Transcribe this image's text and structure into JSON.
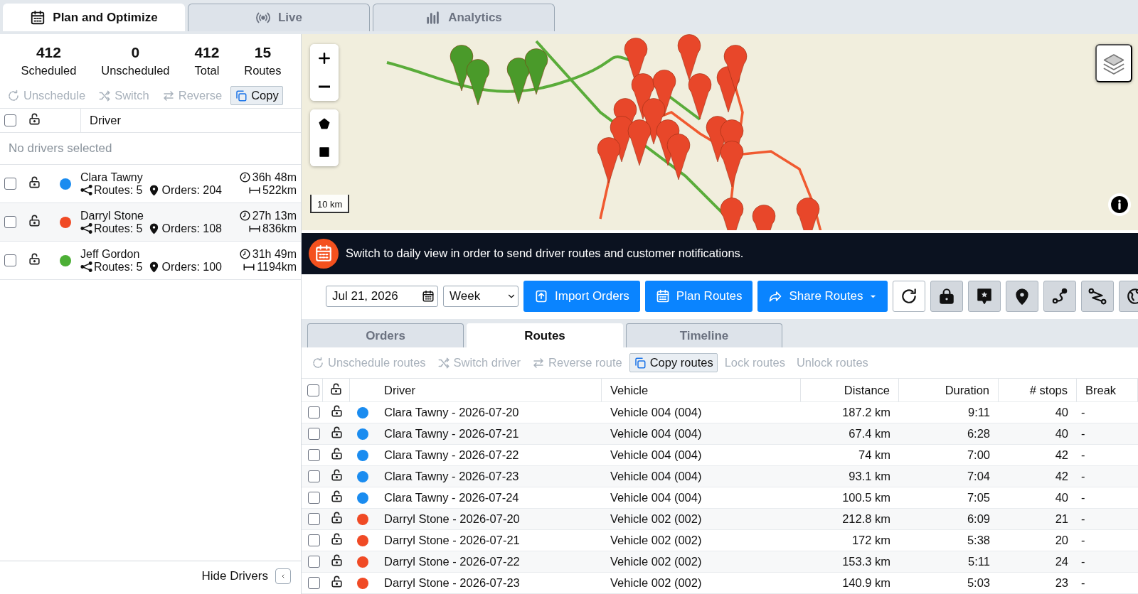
{
  "top_tabs": [
    {
      "label": "Plan and Optimize",
      "selected": true
    },
    {
      "label": "Live",
      "selected": false
    },
    {
      "label": "Analytics",
      "selected": false
    }
  ],
  "summary": [
    {
      "value": "412",
      "label": "Scheduled"
    },
    {
      "value": "0",
      "label": "Unscheduled"
    },
    {
      "value": "412",
      "label": "Total"
    },
    {
      "value": "15",
      "label": "Routes"
    }
  ],
  "driver_actions": [
    {
      "label": "Unschedule",
      "disabled": true
    },
    {
      "label": "Switch",
      "disabled": true
    },
    {
      "label": "Reverse",
      "disabled": true
    },
    {
      "label": "Copy",
      "disabled": false
    }
  ],
  "driver_table": {
    "header": "Driver",
    "all_checked": false,
    "empty_message": "No drivers selected",
    "drivers": [
      {
        "name": "Clara Tawny",
        "color": "#1a8cf0",
        "checked": false,
        "routes": "Routes: 5",
        "orders": "Orders: 204",
        "duration": "36h 48m",
        "distance": "522km"
      },
      {
        "name": "Darryl Stone",
        "color": "#f04a25",
        "checked": false,
        "routes": "Routes: 5",
        "orders": "Orders: 108",
        "duration": "27h 13m",
        "distance": "836km"
      },
      {
        "name": "Jeff Gordon",
        "color": "#4caf35",
        "checked": false,
        "routes": "Routes: 5",
        "orders": "Orders: 100",
        "duration": "31h 49m",
        "distance": "1194km"
      }
    ]
  },
  "hide_drivers": "Hide Drivers",
  "map": {
    "scale": "10 km"
  },
  "banner": "Switch to daily view in order to send driver routes and customer notifications.",
  "toolbar": {
    "date": "Jul 21, 2026",
    "period": "Week",
    "buttons": [
      {
        "label": "Import Orders"
      },
      {
        "label": "Plan Routes"
      },
      {
        "label": "Share Routes"
      }
    ]
  },
  "sub_tabs": [
    {
      "label": "Orders",
      "selected": false
    },
    {
      "label": "Routes",
      "selected": true
    },
    {
      "label": "Timeline",
      "selected": false
    }
  ],
  "route_actions": [
    {
      "label": "Unschedule routes",
      "disabled": true
    },
    {
      "label": "Switch driver",
      "disabled": true
    },
    {
      "label": "Reverse route",
      "disabled": true
    },
    {
      "label": "Copy routes",
      "disabled": false
    },
    {
      "label": "Lock routes",
      "disabled": true
    },
    {
      "label": "Unlock routes",
      "disabled": true
    }
  ],
  "routes_table": {
    "columns": [
      "Driver",
      "Vehicle",
      "Distance",
      "Duration",
      "# stops",
      "Break"
    ],
    "all_checked": false,
    "rows": [
      {
        "checked": false,
        "color": "#1a8cf0",
        "driver": "Clara Tawny - 2026-07-20",
        "vehicle": "Vehicle 004 (004)",
        "distance": "187.2 km",
        "duration": "9:11",
        "stops": "40",
        "break": "-"
      },
      {
        "checked": false,
        "color": "#1a8cf0",
        "driver": "Clara Tawny - 2026-07-21",
        "vehicle": "Vehicle 004 (004)",
        "distance": "67.4 km",
        "duration": "6:28",
        "stops": "40",
        "break": "-"
      },
      {
        "checked": false,
        "color": "#1a8cf0",
        "driver": "Clara Tawny - 2026-07-22",
        "vehicle": "Vehicle 004 (004)",
        "distance": "74 km",
        "duration": "7:00",
        "stops": "42",
        "break": "-"
      },
      {
        "checked": false,
        "color": "#1a8cf0",
        "driver": "Clara Tawny - 2026-07-23",
        "vehicle": "Vehicle 004 (004)",
        "distance": "93.1 km",
        "duration": "7:04",
        "stops": "42",
        "break": "-"
      },
      {
        "checked": false,
        "color": "#1a8cf0",
        "driver": "Clara Tawny - 2026-07-24",
        "vehicle": "Vehicle 004 (004)",
        "distance": "100.5 km",
        "duration": "7:05",
        "stops": "40",
        "break": "-"
      },
      {
        "checked": false,
        "color": "#f04a25",
        "driver": "Darryl Stone - 2026-07-20",
        "vehicle": "Vehicle 002 (002)",
        "distance": "212.8 km",
        "duration": "6:09",
        "stops": "21",
        "break": "-"
      },
      {
        "checked": false,
        "color": "#f04a25",
        "driver": "Darryl Stone - 2026-07-21",
        "vehicle": "Vehicle 002 (002)",
        "distance": "172 km",
        "duration": "5:38",
        "stops": "20",
        "break": "-"
      },
      {
        "checked": false,
        "color": "#f04a25",
        "driver": "Darryl Stone - 2026-07-22",
        "vehicle": "Vehicle 002 (002)",
        "distance": "153.3 km",
        "duration": "5:11",
        "stops": "24",
        "break": "-"
      },
      {
        "checked": false,
        "color": "#f04a25",
        "driver": "Darryl Stone - 2026-07-23",
        "vehicle": "Vehicle 002 (002)",
        "distance": "140.9 km",
        "duration": "5:03",
        "stops": "23",
        "break": "-"
      }
    ]
  }
}
